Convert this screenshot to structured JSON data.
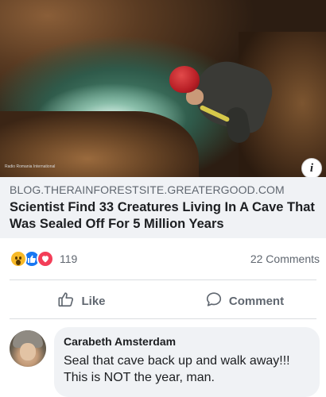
{
  "post_image": {
    "watermark": "Radio Romania International",
    "info_icon": "info-icon"
  },
  "link": {
    "domain": "BLOG.THERAINFORESTSITE.GREATERGOOD.COM",
    "title": "Scientist Find 33 Creatures Living In A Cave That Was Sealed Off For 5 Million Years"
  },
  "reactions": {
    "icons": [
      "wow-reaction-icon",
      "like-reaction-icon",
      "love-reaction-icon"
    ],
    "count": "119",
    "comments": "22 Comments"
  },
  "actions": {
    "like_label": "Like",
    "comment_label": "Comment"
  },
  "comment": {
    "author": "Carabeth Amsterdam",
    "text": "Seal that cave back up and walk away!!! This is NOT the year, man."
  },
  "colors": {
    "link_card_bg": "#f0f2f5",
    "like_blue": "#1877f2",
    "love_red": "#f33e58",
    "wow_yellow": "#f7b928",
    "secondary_text": "#606770"
  }
}
